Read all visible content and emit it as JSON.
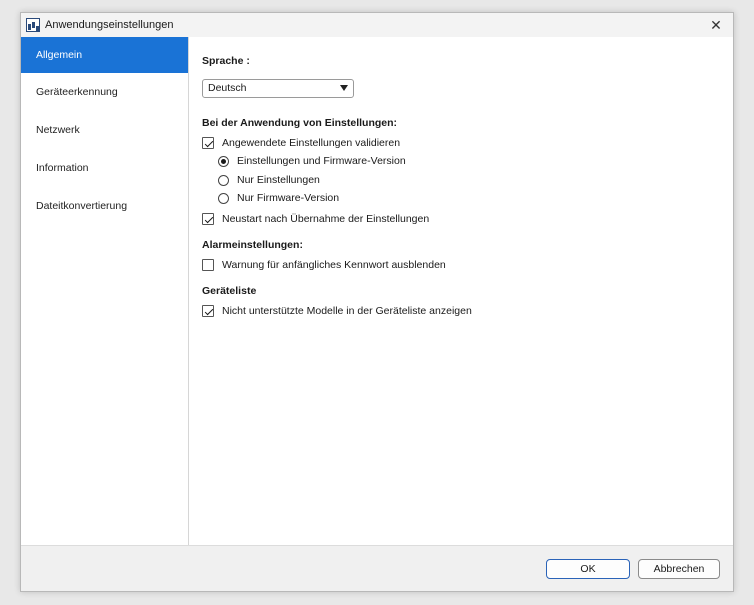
{
  "window": {
    "title": "Anwendungseinstellungen",
    "close_glyph": "✕"
  },
  "sidebar": {
    "items": [
      {
        "label": "Allgemein",
        "active": true
      },
      {
        "label": "Geräteerkennung",
        "active": false
      },
      {
        "label": "Netzwerk",
        "active": false
      },
      {
        "label": "Information",
        "active": false
      },
      {
        "label": "Dateitkonvertierung",
        "active": false
      }
    ]
  },
  "general": {
    "language_label": "Sprache :",
    "language_value": "Deutsch",
    "apply_heading": "Bei der Anwendung von Einstellungen:",
    "validate_label": "Angewendete Einstellungen validieren",
    "validate_checked": true,
    "radio_options": [
      {
        "label": "Einstellungen und Firmware-Version",
        "checked": true
      },
      {
        "label": "Nur Einstellungen",
        "checked": false
      },
      {
        "label": "Nur Firmware-Version",
        "checked": false
      }
    ],
    "restart_label": "Neustart nach Übernahme der Einstellungen",
    "restart_checked": true,
    "alarm_heading": "Alarmeinstellungen:",
    "alarm_label": "Warnung für anfängliches Kennwort ausblenden",
    "alarm_checked": false,
    "devicelist_heading": "Geräteliste",
    "devicelist_label": "Nicht unterstützte Modelle in der Geräteliste anzeigen",
    "devicelist_checked": true
  },
  "footer": {
    "ok_label": "OK",
    "cancel_label": "Abbrechen"
  },
  "colors": {
    "accent": "#1a73d6"
  }
}
